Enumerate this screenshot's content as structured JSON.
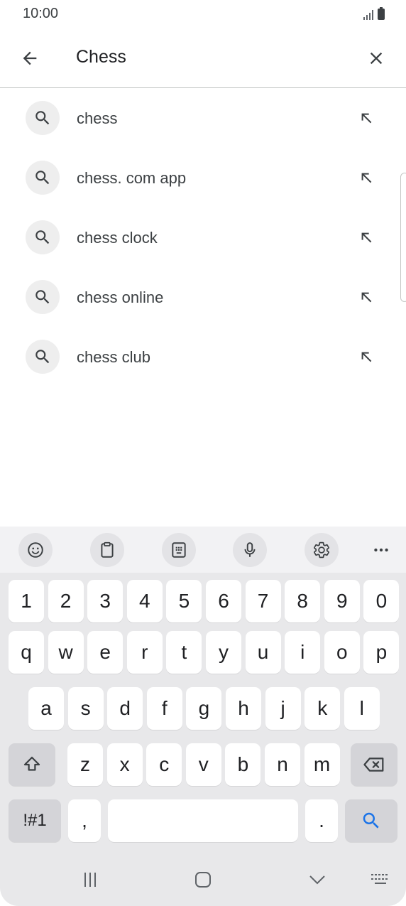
{
  "status_bar": {
    "time": "10:00"
  },
  "search": {
    "query": "Chess"
  },
  "suggestions": [
    {
      "label": "chess"
    },
    {
      "label": "chess. com app"
    },
    {
      "label": "chess clock"
    },
    {
      "label": "chess online"
    },
    {
      "label": "chess club"
    }
  ],
  "keyboard": {
    "number_row": [
      "1",
      "2",
      "3",
      "4",
      "5",
      "6",
      "7",
      "8",
      "9",
      "0"
    ],
    "row1": [
      "q",
      "w",
      "e",
      "r",
      "t",
      "y",
      "u",
      "i",
      "o",
      "p"
    ],
    "row2": [
      "a",
      "s",
      "d",
      "f",
      "g",
      "h",
      "j",
      "k",
      "l"
    ],
    "row3": [
      "z",
      "x",
      "c",
      "v",
      "b",
      "n",
      "m"
    ],
    "symbols_label": "!#1",
    "comma_label": ",",
    "period_label": ".",
    "space_label": ""
  },
  "colors": {
    "accent": "#1a73e8",
    "icon_gray": "#5f6368",
    "keyboard_bg": "#e8e8ea"
  }
}
